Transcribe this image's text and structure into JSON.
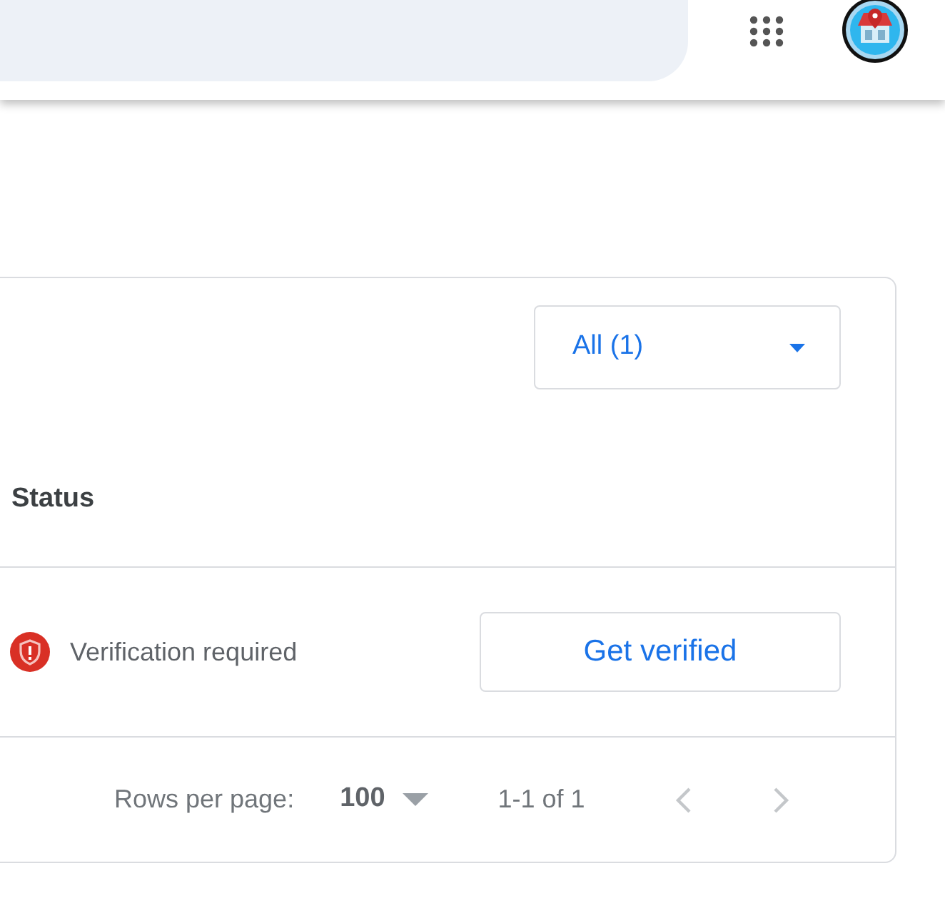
{
  "filter": {
    "value": "All (1)"
  },
  "table": {
    "columns": [
      "Status"
    ],
    "rows": [
      {
        "status": "Verification required",
        "action": "Get verified"
      }
    ]
  },
  "pagination": {
    "rows_per_page_label": "Rows per page:",
    "rows_per_page": "100",
    "range": "1-1 of 1",
    "prev_disabled": true,
    "next_disabled": true
  }
}
